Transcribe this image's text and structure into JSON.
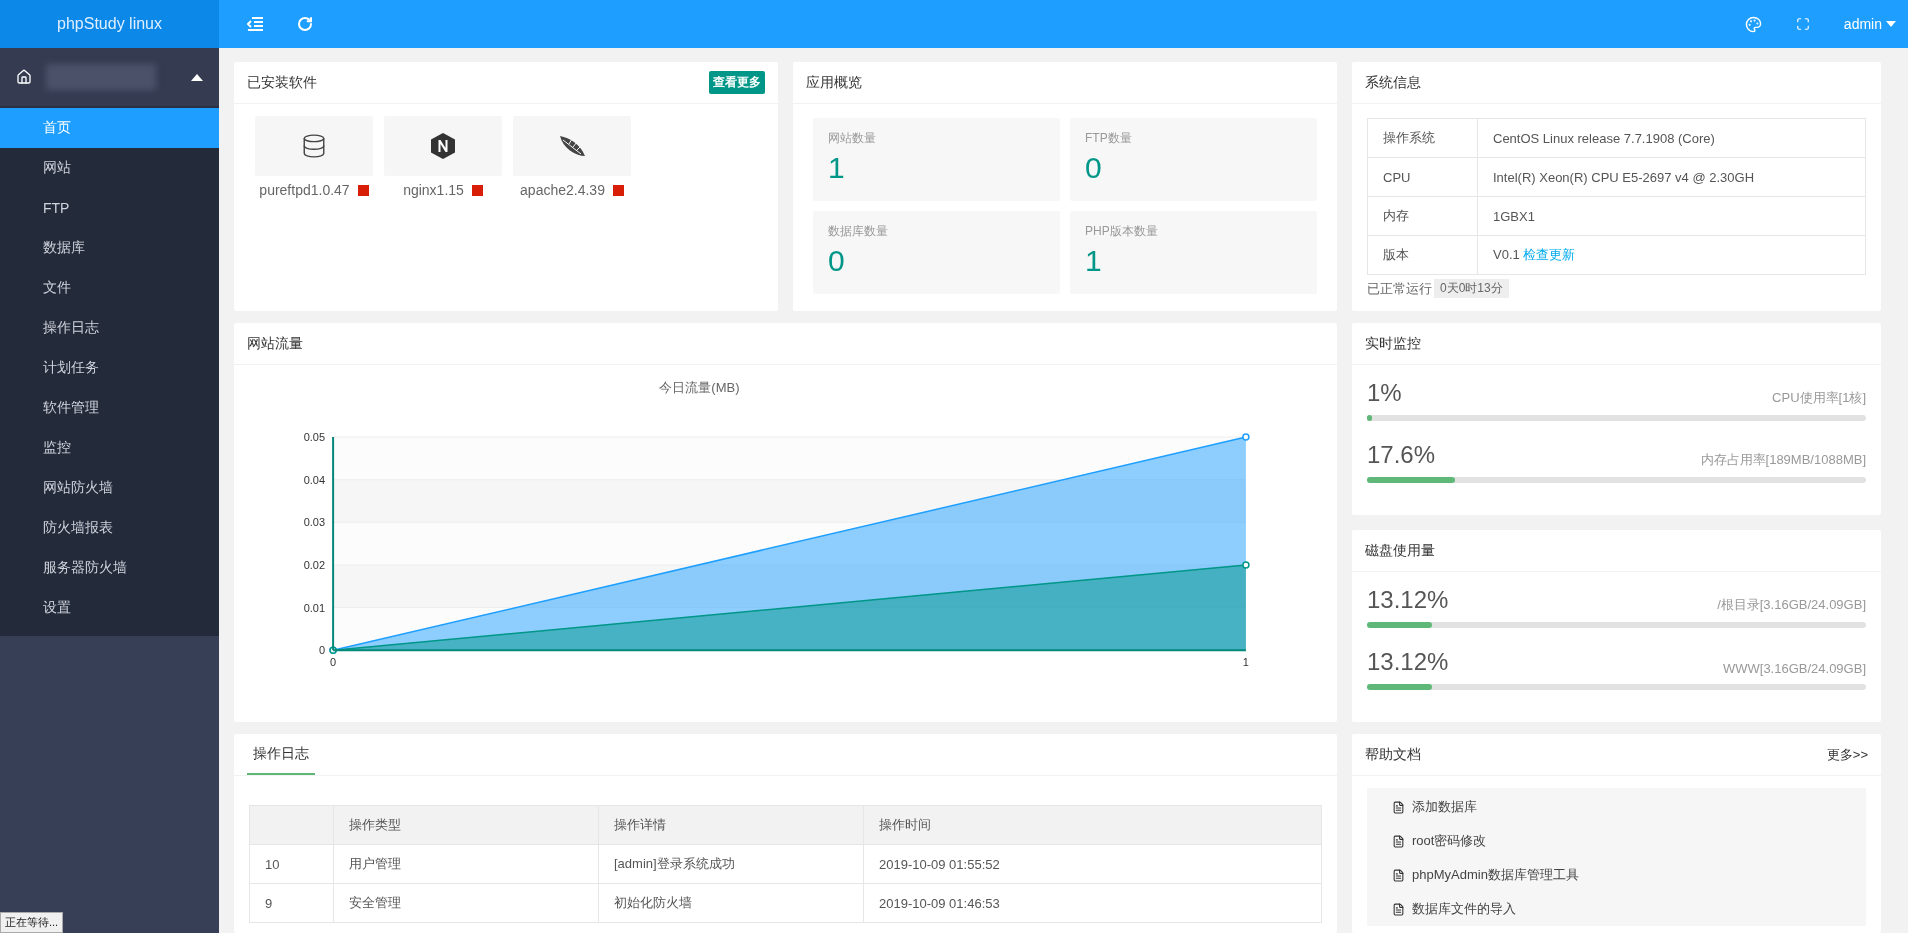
{
  "header": {
    "logo": "phpStudy linux",
    "user": "admin"
  },
  "sidebar": {
    "items": [
      {
        "label": "首页",
        "selected": true
      },
      {
        "label": "网站",
        "selected": false
      },
      {
        "label": "FTP",
        "selected": false
      },
      {
        "label": "数据库",
        "selected": false
      },
      {
        "label": "文件",
        "selected": false
      },
      {
        "label": "操作日志",
        "selected": false
      },
      {
        "label": "计划任务",
        "selected": false
      },
      {
        "label": "软件管理",
        "selected": false
      },
      {
        "label": "监控",
        "selected": false
      },
      {
        "label": "网站防火墙",
        "selected": false
      },
      {
        "label": "防火墙报表",
        "selected": false
      },
      {
        "label": "服务器防火墙",
        "selected": false
      },
      {
        "label": "设置",
        "selected": false
      }
    ]
  },
  "installed": {
    "title": "已安装软件",
    "more": "查看更多",
    "items": [
      {
        "kind": "ftp",
        "name": "pureftpd1.0.47",
        "running": false
      },
      {
        "kind": "nginx",
        "name": "nginx1.15",
        "running": false
      },
      {
        "kind": "apache",
        "name": "apache2.4.39",
        "running": false
      }
    ]
  },
  "overview": {
    "title": "应用概览",
    "stats": [
      {
        "label": "网站数量",
        "value": "1"
      },
      {
        "label": "FTP数量",
        "value": "0"
      },
      {
        "label": "数据库数量",
        "value": "0"
      },
      {
        "label": "PHP版本数量",
        "value": "1"
      }
    ]
  },
  "system": {
    "title": "系统信息",
    "rows": [
      {
        "label": "操作系统",
        "value": "CentOS Linux release 7.7.1908 (Core)"
      },
      {
        "label": "CPU",
        "value": "Intel(R) Xeon(R) CPU E5-2697 v4 @ 2.30GH"
      },
      {
        "label": "内存",
        "value": "1GBX1"
      },
      {
        "label": "版本",
        "value": "V0.1",
        "link": "检查更新"
      }
    ],
    "uptime_label": "已正常运行",
    "uptime": "0天0时13分"
  },
  "traffic": {
    "title": "网站流量",
    "chart_data": {
      "type": "area",
      "title": "今日流量(MB)",
      "x": [
        0,
        1
      ],
      "series": [
        {
          "color": "#1e9fff",
          "values": [
            0,
            0.05
          ]
        },
        {
          "color": "#009688",
          "values": [
            0,
            0.02
          ]
        }
      ],
      "xticks": [
        0,
        1
      ],
      "yticks": [
        0,
        0.01,
        0.02,
        0.03,
        0.04,
        0.05
      ],
      "ylim": [
        0,
        0.05
      ],
      "xlim": [
        0,
        1
      ],
      "grid": true
    }
  },
  "monitor": {
    "title": "实时监控",
    "meters": [
      {
        "value": "1%",
        "label": "CPU使用率[1核]",
        "level": 0.01
      },
      {
        "value": "17.6%",
        "label": "内存占用率[189MB/1088MB]",
        "level": 0.176
      }
    ]
  },
  "disk": {
    "title": "磁盘使用量",
    "meters": [
      {
        "value": "13.12%",
        "label": "/根目录[3.16GB/24.09GB]",
        "level": 0.1312
      },
      {
        "value": "13.12%",
        "label": "WWW[3.16GB/24.09GB]",
        "level": 0.1312
      }
    ]
  },
  "log": {
    "tabs": [
      {
        "label": "操作日志",
        "selected": true
      }
    ],
    "columns": [
      "",
      "操作类型",
      "操作详情",
      "操作时间"
    ],
    "rows": [
      [
        "10",
        "用户管理",
        "[admin]登录系统成功",
        "2019-10-09 01:55:52"
      ],
      [
        "9",
        "安全管理",
        "初始化防火墙",
        "2019-10-09 01:46:53"
      ]
    ]
  },
  "help": {
    "title": "帮助文档",
    "more": "更多>>",
    "items": [
      "添加数据库",
      "root密码修改",
      "phpMyAdmin数据库管理工具",
      "数据库文件的导入"
    ]
  },
  "browser_status": "正在等待..."
}
